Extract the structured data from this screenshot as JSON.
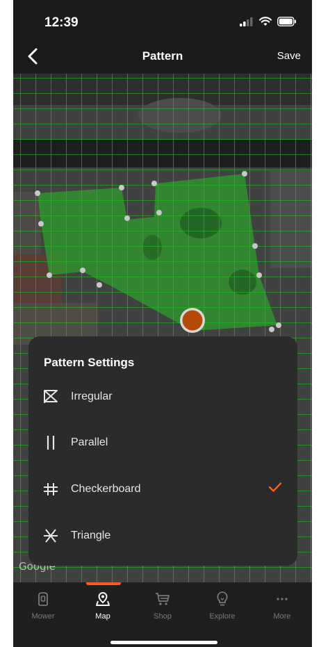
{
  "status_bar": {
    "time": "12:39",
    "icons": [
      "signal-icon",
      "wifi-icon",
      "battery-icon"
    ]
  },
  "header": {
    "back_icon": "chevron-left-icon",
    "title": "Pattern",
    "save_label": "Save"
  },
  "map": {
    "attribution": "Google",
    "grid_color": "#19c419",
    "area_fill_color": "#2ea12e",
    "mower_marker_color": "#b34a08"
  },
  "pattern_settings": {
    "title": "Pattern Settings",
    "options": [
      {
        "label": "Irregular",
        "icon": "irregular-pattern-icon",
        "selected": false
      },
      {
        "label": "Parallel",
        "icon": "parallel-pattern-icon",
        "selected": false
      },
      {
        "label": "Checkerboard",
        "icon": "checkerboard-pattern-icon",
        "selected": true
      },
      {
        "label": "Triangle",
        "icon": "triangle-pattern-icon",
        "selected": false
      }
    ],
    "check_icon": "checkmark-icon",
    "accent_color": "#ff6a2a"
  },
  "tabbar": {
    "active": "Map",
    "tabs": [
      {
        "label": "Mower",
        "icon": "mower-icon"
      },
      {
        "label": "Map",
        "icon": "map-pin-icon"
      },
      {
        "label": "Shop",
        "icon": "cart-icon"
      },
      {
        "label": "Explore",
        "icon": "lightbulb-icon"
      },
      {
        "label": "More",
        "icon": "more-dots-icon"
      }
    ]
  }
}
